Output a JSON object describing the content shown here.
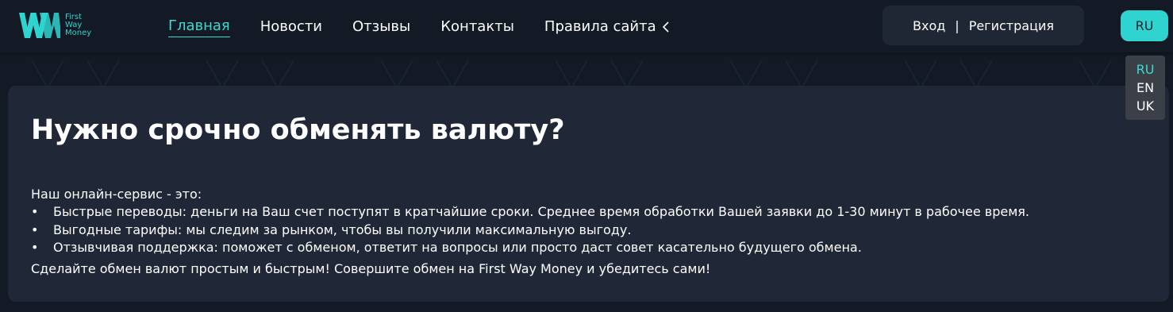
{
  "header": {
    "logo": {
      "line1": "First",
      "line2": "Way",
      "line3": "Money",
      "accent_color": "#2fd3cf"
    },
    "nav": [
      {
        "label": "Главная",
        "active": true
      },
      {
        "label": "Новости",
        "active": false
      },
      {
        "label": "Отзывы",
        "active": false
      },
      {
        "label": "Контакты",
        "active": false
      },
      {
        "label": "Правила сайта",
        "active": false,
        "icon": "chevron-left-icon"
      }
    ],
    "auth": {
      "login": "Вход",
      "separator": "|",
      "register": "Регистрация"
    },
    "language": {
      "current": "RU",
      "options": [
        "RU",
        "EN",
        "UK"
      ]
    }
  },
  "main": {
    "title": "Нужно срочно обменять валюту?",
    "intro": "Наш онлайн-сервис - это:",
    "bullets": [
      "Быстрые переводы: деньги на Ваш счет поступят в кратчайшие сроки. Среднее время обработки Вашей заявки до 1-30 минут в рабочее время.",
      "Выгодные тарифы: мы следим за рынком, чтобы вы получили максимальную выгоду.",
      "Отзывчивая поддержка: поможет с обменом, ответит на вопросы или просто даст совет касательно будущего обмена."
    ],
    "bullet_glyph": "•",
    "outro": "Сделайте обмен валют простым и быстрым! Совершите обмен на First Way Money и убедитесь сами!"
  },
  "colors": {
    "background": "#141a25",
    "card": "#202838",
    "accent": "#2fd3cf"
  }
}
